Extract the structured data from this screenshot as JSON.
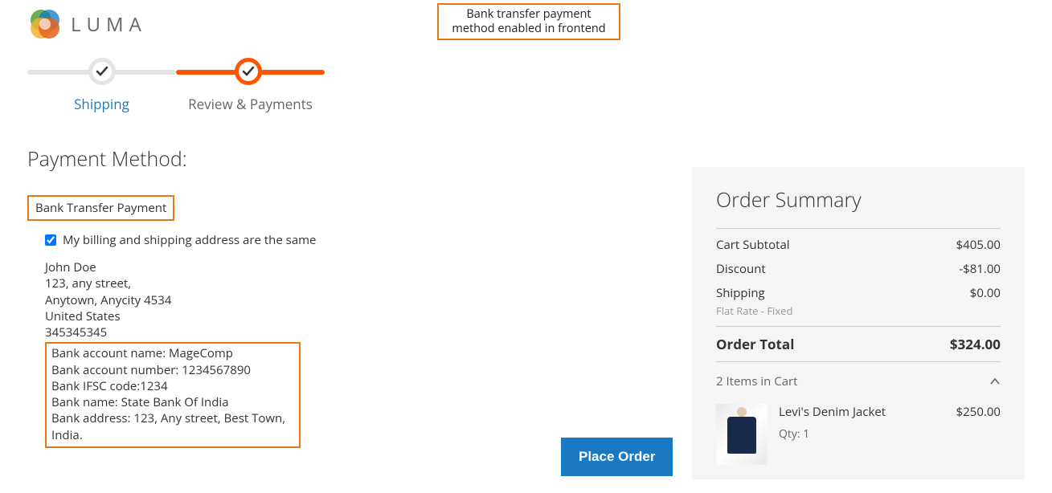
{
  "logo": {
    "text": "LUMA"
  },
  "annotation": {
    "text": "Bank transfer payment method enabled in frontend"
  },
  "progress": {
    "step1_label": "Shipping",
    "step2_label": "Review & Payments"
  },
  "payment": {
    "heading": "Payment Method:",
    "method_title": "Bank Transfer Payment",
    "same_address_label": "My billing and shipping address are the same",
    "address": {
      "name": "John Doe",
      "street": "123, any street,",
      "city": "Anytown, Anycity 4534",
      "country": "United States",
      "phone": "345345345"
    },
    "bank": {
      "line1": "Bank account name: MageComp",
      "line2": "Bank account number: 1234567890",
      "line3": "Bank IFSC code:1234",
      "line4": "Bank name: State Bank Of India",
      "line5": "Bank address: 123, Any street, Best Town, India."
    },
    "place_order_label": "Place Order"
  },
  "summary": {
    "title": "Order Summary",
    "subtotal_label": "Cart Subtotal",
    "subtotal_value": "$405.00",
    "discount_label": "Discount",
    "discount_value": "-$81.00",
    "shipping_label": "Shipping",
    "shipping_value": "$0.00",
    "shipping_method": "Flat Rate - Fixed",
    "total_label": "Order Total",
    "total_value": "$324.00",
    "cart_count_label": "2 Items in Cart",
    "item": {
      "name": "Levi's Denim Jacket",
      "price": "$250.00",
      "qty_label": "Qty: 1"
    }
  }
}
